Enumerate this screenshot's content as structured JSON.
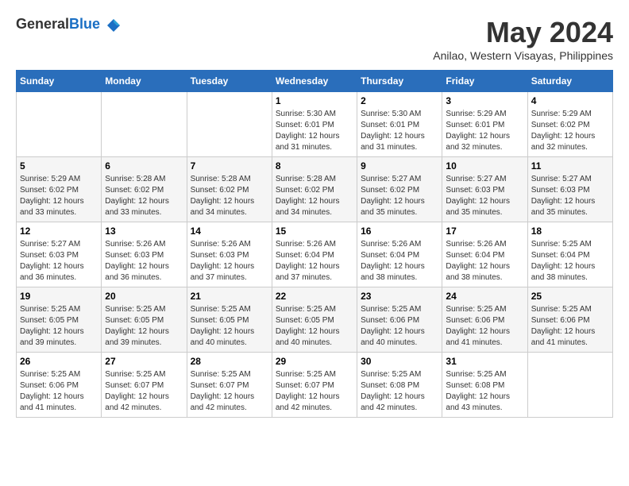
{
  "header": {
    "logo_general": "General",
    "logo_blue": "Blue",
    "month_title": "May 2024",
    "location": "Anilao, Western Visayas, Philippines"
  },
  "weekdays": [
    "Sunday",
    "Monday",
    "Tuesday",
    "Wednesday",
    "Thursday",
    "Friday",
    "Saturday"
  ],
  "weeks": [
    [
      {
        "day": "",
        "info": ""
      },
      {
        "day": "",
        "info": ""
      },
      {
        "day": "",
        "info": ""
      },
      {
        "day": "1",
        "sunrise": "5:30 AM",
        "sunset": "6:01 PM",
        "daylight": "12 hours and 31 minutes."
      },
      {
        "day": "2",
        "sunrise": "5:30 AM",
        "sunset": "6:01 PM",
        "daylight": "12 hours and 31 minutes."
      },
      {
        "day": "3",
        "sunrise": "5:29 AM",
        "sunset": "6:01 PM",
        "daylight": "12 hours and 32 minutes."
      },
      {
        "day": "4",
        "sunrise": "5:29 AM",
        "sunset": "6:02 PM",
        "daylight": "12 hours and 32 minutes."
      }
    ],
    [
      {
        "day": "5",
        "sunrise": "5:29 AM",
        "sunset": "6:02 PM",
        "daylight": "12 hours and 33 minutes."
      },
      {
        "day": "6",
        "sunrise": "5:28 AM",
        "sunset": "6:02 PM",
        "daylight": "12 hours and 33 minutes."
      },
      {
        "day": "7",
        "sunrise": "5:28 AM",
        "sunset": "6:02 PM",
        "daylight": "12 hours and 34 minutes."
      },
      {
        "day": "8",
        "sunrise": "5:28 AM",
        "sunset": "6:02 PM",
        "daylight": "12 hours and 34 minutes."
      },
      {
        "day": "9",
        "sunrise": "5:27 AM",
        "sunset": "6:02 PM",
        "daylight": "12 hours and 35 minutes."
      },
      {
        "day": "10",
        "sunrise": "5:27 AM",
        "sunset": "6:03 PM",
        "daylight": "12 hours and 35 minutes."
      },
      {
        "day": "11",
        "sunrise": "5:27 AM",
        "sunset": "6:03 PM",
        "daylight": "12 hours and 35 minutes."
      }
    ],
    [
      {
        "day": "12",
        "sunrise": "5:27 AM",
        "sunset": "6:03 PM",
        "daylight": "12 hours and 36 minutes."
      },
      {
        "day": "13",
        "sunrise": "5:26 AM",
        "sunset": "6:03 PM",
        "daylight": "12 hours and 36 minutes."
      },
      {
        "day": "14",
        "sunrise": "5:26 AM",
        "sunset": "6:03 PM",
        "daylight": "12 hours and 37 minutes."
      },
      {
        "day": "15",
        "sunrise": "5:26 AM",
        "sunset": "6:04 PM",
        "daylight": "12 hours and 37 minutes."
      },
      {
        "day": "16",
        "sunrise": "5:26 AM",
        "sunset": "6:04 PM",
        "daylight": "12 hours and 38 minutes."
      },
      {
        "day": "17",
        "sunrise": "5:26 AM",
        "sunset": "6:04 PM",
        "daylight": "12 hours and 38 minutes."
      },
      {
        "day": "18",
        "sunrise": "5:25 AM",
        "sunset": "6:04 PM",
        "daylight": "12 hours and 38 minutes."
      }
    ],
    [
      {
        "day": "19",
        "sunrise": "5:25 AM",
        "sunset": "6:05 PM",
        "daylight": "12 hours and 39 minutes."
      },
      {
        "day": "20",
        "sunrise": "5:25 AM",
        "sunset": "6:05 PM",
        "daylight": "12 hours and 39 minutes."
      },
      {
        "day": "21",
        "sunrise": "5:25 AM",
        "sunset": "6:05 PM",
        "daylight": "12 hours and 40 minutes."
      },
      {
        "day": "22",
        "sunrise": "5:25 AM",
        "sunset": "6:05 PM",
        "daylight": "12 hours and 40 minutes."
      },
      {
        "day": "23",
        "sunrise": "5:25 AM",
        "sunset": "6:06 PM",
        "daylight": "12 hours and 40 minutes."
      },
      {
        "day": "24",
        "sunrise": "5:25 AM",
        "sunset": "6:06 PM",
        "daylight": "12 hours and 41 minutes."
      },
      {
        "day": "25",
        "sunrise": "5:25 AM",
        "sunset": "6:06 PM",
        "daylight": "12 hours and 41 minutes."
      }
    ],
    [
      {
        "day": "26",
        "sunrise": "5:25 AM",
        "sunset": "6:06 PM",
        "daylight": "12 hours and 41 minutes."
      },
      {
        "day": "27",
        "sunrise": "5:25 AM",
        "sunset": "6:07 PM",
        "daylight": "12 hours and 42 minutes."
      },
      {
        "day": "28",
        "sunrise": "5:25 AM",
        "sunset": "6:07 PM",
        "daylight": "12 hours and 42 minutes."
      },
      {
        "day": "29",
        "sunrise": "5:25 AM",
        "sunset": "6:07 PM",
        "daylight": "12 hours and 42 minutes."
      },
      {
        "day": "30",
        "sunrise": "5:25 AM",
        "sunset": "6:08 PM",
        "daylight": "12 hours and 42 minutes."
      },
      {
        "day": "31",
        "sunrise": "5:25 AM",
        "sunset": "6:08 PM",
        "daylight": "12 hours and 43 minutes."
      },
      {
        "day": "",
        "info": ""
      }
    ]
  ],
  "labels": {
    "sunrise": "Sunrise:",
    "sunset": "Sunset:",
    "daylight": "Daylight:"
  }
}
